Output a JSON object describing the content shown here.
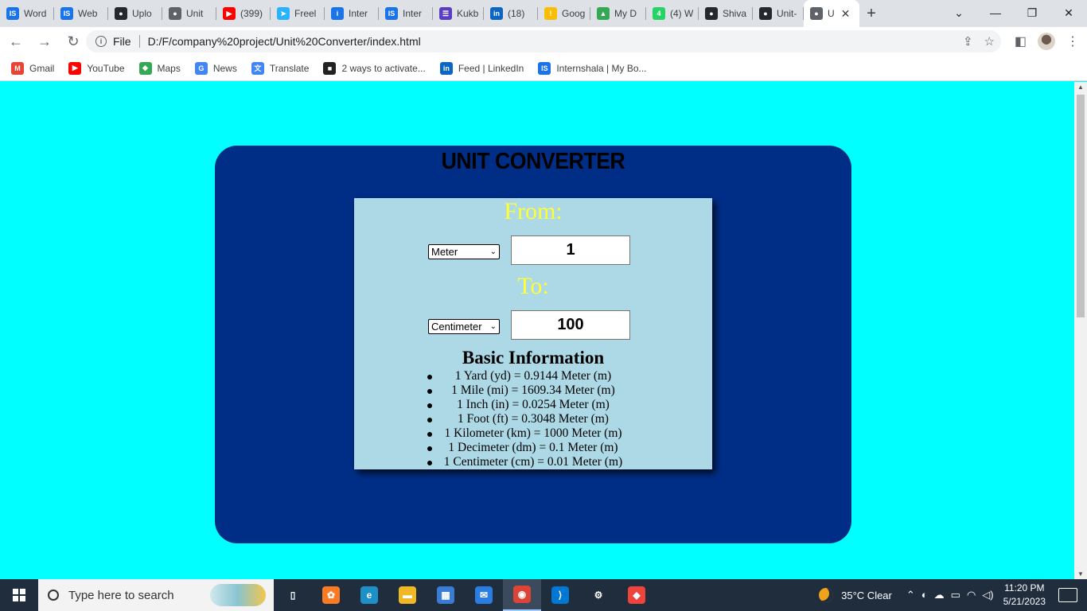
{
  "browser": {
    "tabs": [
      {
        "label": "Word",
        "icon": "internshala-icon",
        "color": "#1a73e8",
        "glyph": "IS"
      },
      {
        "label": "Web",
        "icon": "internshala-icon",
        "color": "#1a73e8",
        "glyph": "IS"
      },
      {
        "label": "Uplo",
        "icon": "github-icon",
        "color": "#24292f",
        "glyph": "●"
      },
      {
        "label": "Unit",
        "icon": "globe-icon",
        "color": "#5f6368",
        "glyph": "●"
      },
      {
        "label": "(399)",
        "icon": "youtube-icon",
        "color": "#ff0000",
        "glyph": "▶"
      },
      {
        "label": "Freel",
        "icon": "freelancer-icon",
        "color": "#29b2fe",
        "glyph": "➤"
      },
      {
        "label": "Inter",
        "icon": "internshala-icon",
        "color": "#1a73e8",
        "glyph": "i"
      },
      {
        "label": "Inter",
        "icon": "internshala-icon",
        "color": "#1a73e8",
        "glyph": "IS"
      },
      {
        "label": "Kukb",
        "icon": "kukbuk-icon",
        "color": "#5b3cc4",
        "glyph": "☰"
      },
      {
        "label": "(18)",
        "icon": "linkedin-icon",
        "color": "#0a66c2",
        "glyph": "in"
      },
      {
        "label": "Goog",
        "icon": "google-icon",
        "color": "#fbbc04",
        "glyph": "!"
      },
      {
        "label": "My D",
        "icon": "drive-icon",
        "color": "#34a853",
        "glyph": "▲"
      },
      {
        "label": "(4) W",
        "icon": "whatsapp-icon",
        "color": "#25d366",
        "glyph": "4"
      },
      {
        "label": "Shiva",
        "icon": "github-icon",
        "color": "#24292f",
        "glyph": "●"
      },
      {
        "label": "Unit-",
        "icon": "github-icon",
        "color": "#24292f",
        "glyph": "●"
      },
      {
        "label": "U",
        "icon": "globe-icon",
        "color": "#5f6368",
        "glyph": "●"
      }
    ],
    "url_scheme": "File",
    "url": "D:/F/company%20project/Unit%20Converter/index.html",
    "bookmarks": [
      {
        "label": "Gmail",
        "color": "#ea4335",
        "glyph": "M"
      },
      {
        "label": "YouTube",
        "color": "#ff0000",
        "glyph": "▶"
      },
      {
        "label": "Maps",
        "color": "#34a853",
        "glyph": "◆"
      },
      {
        "label": "News",
        "color": "#4285f4",
        "glyph": "G"
      },
      {
        "label": "Translate",
        "color": "#4285f4",
        "glyph": "文"
      },
      {
        "label": "2 ways to activate...",
        "color": "#222222",
        "glyph": "■"
      },
      {
        "label": "Feed | LinkedIn",
        "color": "#0a66c2",
        "glyph": "in"
      },
      {
        "label": "Internshala | My Bo...",
        "color": "#1a73e8",
        "glyph": "IS"
      }
    ]
  },
  "converter": {
    "title": "UNIT CONVERTER",
    "from_label": "From:",
    "from_unit": "Meter",
    "from_value": "1",
    "to_label": "To:",
    "to_unit": "Centimeter",
    "to_value": "100",
    "info_title": "Basic Information",
    "info_items": [
      "1 Yard (yd) = 0.9144 Meter (m)",
      "1 Mile (mi) = 1609.34 Meter (m)",
      "1 Inch (in) = 0.0254 Meter (m)",
      "1 Foot (ft) = 0.3048 Meter (m)",
      "1 Kilometer (km) = 1000 Meter (m)",
      "1 Decimeter (dm) = 0.1 Meter (m)",
      "1 Centimeter (cm) = 0.01 Meter (m)"
    ],
    "colors": {
      "page_bg": "#00ffff",
      "outer_bg": "#002e87",
      "inner_bg": "#add8e6",
      "label_color": "#ffff33"
    }
  },
  "taskbar": {
    "search_placeholder": "Type here to search",
    "weather": "35°C  Clear",
    "time": "11:20 PM",
    "date": "5/21/2023",
    "apps": [
      {
        "name": "task-view-icon",
        "color": "#1f2d3d",
        "glyph": "▯"
      },
      {
        "name": "xampp-icon",
        "color": "#fb7a24",
        "glyph": "✿"
      },
      {
        "name": "edge-icon",
        "color": "#1e90c8",
        "glyph": "e"
      },
      {
        "name": "file-explorer-icon",
        "color": "#f2b724",
        "glyph": "▬"
      },
      {
        "name": "store-icon",
        "color": "#3a7bd5",
        "glyph": "▦"
      },
      {
        "name": "mail-icon",
        "color": "#2a7de1",
        "glyph": "✉"
      },
      {
        "name": "chrome-icon",
        "color": "#db4437",
        "glyph": "◉"
      },
      {
        "name": "vscode-icon",
        "color": "#0078d4",
        "glyph": "⟩"
      },
      {
        "name": "settings-icon",
        "color": "#1f2d3d",
        "glyph": "⚙"
      },
      {
        "name": "anydesk-icon",
        "color": "#ef443b",
        "glyph": "◆"
      }
    ]
  }
}
